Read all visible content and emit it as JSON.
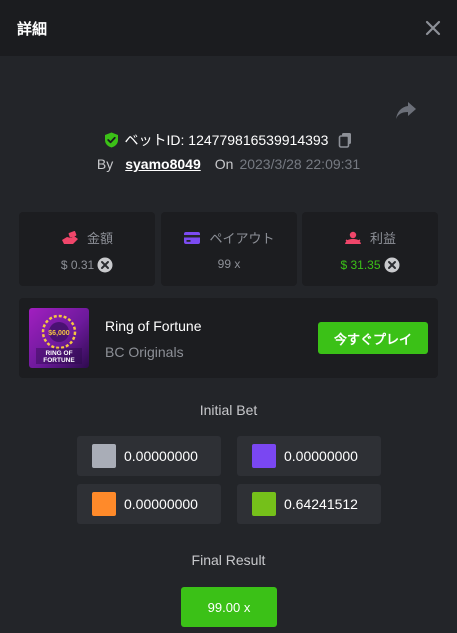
{
  "header": {
    "title": "詳細"
  },
  "bet": {
    "id_text": "ベットID: 124779816539914393"
  },
  "byline": {
    "by_label": "By",
    "username": "syamo8049",
    "on_label": "On",
    "timestamp": "2023/3/28 22:09:31"
  },
  "stats": {
    "amount": {
      "label": "金額",
      "value": "$ 0.31",
      "icon": "amount-hand-icon",
      "icon_color": "#f0466a"
    },
    "payout": {
      "label": "ペイアウト",
      "value": "99 x",
      "icon": "card-icon",
      "icon_color": "#7c4bf2"
    },
    "profit": {
      "label": "利益",
      "value": "$ 31.35",
      "icon": "profit-user-icon",
      "icon_color": "#f0466a",
      "value_color": "#3bc117"
    }
  },
  "game": {
    "name": "Ring of Fortune",
    "provider": "BC Originals",
    "play_label": "今すぐプレイ",
    "thumb_text_top": "$6,000",
    "thumb_text_main": "RING OF FORTUNE"
  },
  "initial_bet": {
    "title": "Initial Bet",
    "items": [
      {
        "color": "#a9adb7",
        "value": "0.00000000"
      },
      {
        "color": "#7a47f2",
        "value": "0.00000000"
      },
      {
        "color": "#ff8a2a",
        "value": "0.00000000"
      },
      {
        "color": "#75c01a",
        "value": "0.64241512"
      }
    ]
  },
  "final_result": {
    "title": "Final Result",
    "value": "99.00 x",
    "color": "#3bc117"
  },
  "colors": {
    "accent_green": "#3bc117",
    "panel_bg": "#232529",
    "card_bg": "#1c1d20",
    "header_bg": "#1b1c1f"
  }
}
